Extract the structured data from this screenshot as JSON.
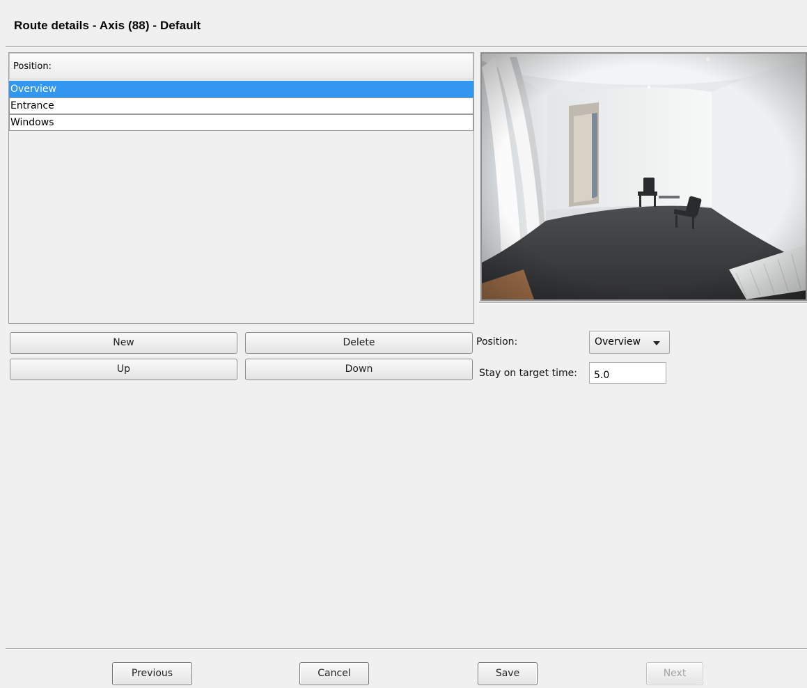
{
  "dialog": {
    "title": "Route details - Axis (88) - Default"
  },
  "position_list": {
    "header": "Position:",
    "items": [
      {
        "label": "Overview",
        "selected": true
      },
      {
        "label": "Entrance",
        "selected": false
      },
      {
        "label": "Windows",
        "selected": false
      }
    ]
  },
  "list_buttons": {
    "new": "New",
    "delete": "Delete",
    "up": "Up",
    "down": "Down"
  },
  "form": {
    "position_label": "Position:",
    "position_value": "Overview",
    "stay_label": "Stay on target time:",
    "stay_value": "5.0"
  },
  "footer": {
    "previous": "Previous",
    "cancel": "Cancel",
    "save": "Save",
    "next": "Next"
  },
  "colors": {
    "selection": "#3397ef",
    "background": "#f0f0f0"
  }
}
